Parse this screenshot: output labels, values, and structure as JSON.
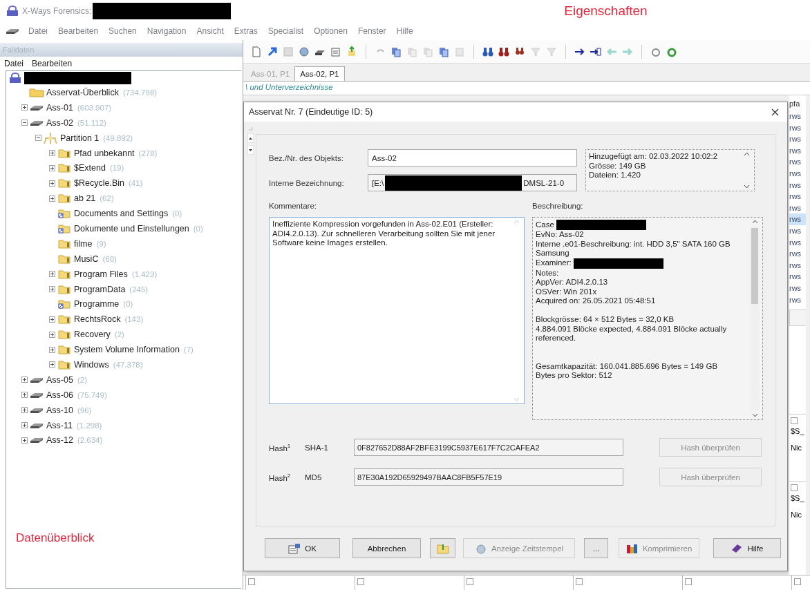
{
  "window": {
    "title": "X-Ways Forensics:",
    "annotation": "Eigenschaften"
  },
  "menu": [
    "Datei",
    "Bearbeiten",
    "Suchen",
    "Navigation",
    "Ansicht",
    "Extras",
    "Specialist",
    "Optionen",
    "Fenster",
    "Hilfe"
  ],
  "case_panel": {
    "title": "Falldaten",
    "menu": [
      "Datei",
      "Bearbeiten"
    ],
    "annotation": "Datenüberblick",
    "tree": [
      {
        "label": "Asservat-Überblick",
        "count": "(734.798)",
        "kind": "overview"
      },
      {
        "label": "Ass-01",
        "count": "(603.907)",
        "kind": "drive",
        "expanded": false
      },
      {
        "label": "Ass-02",
        "count": "(51.112)",
        "kind": "drive",
        "expanded": true,
        "children": [
          {
            "label": "Partition 1",
            "count": "(49.892)",
            "kind": "partition",
            "expanded": true,
            "children": [
              {
                "label": "Pfad unbekannt",
                "count": "(278)",
                "kind": "folder",
                "expanded": false
              },
              {
                "label": "$Extend",
                "count": "(19)",
                "kind": "folder",
                "expanded": false
              },
              {
                "label": "$Recycle.Bin",
                "count": "(41)",
                "kind": "folder",
                "expanded": false
              },
              {
                "label": "ab 21",
                "count": "(62)",
                "kind": "folder",
                "expanded": false
              },
              {
                "label": "Documents and Settings",
                "count": "(0)",
                "kind": "link"
              },
              {
                "label": "Dokumente und Einstellungen",
                "count": "(0)",
                "kind": "link"
              },
              {
                "label": "filme",
                "count": "(9)",
                "kind": "folder"
              },
              {
                "label": "MusiC",
                "count": "(60)",
                "kind": "folder"
              },
              {
                "label": "Program Files",
                "count": "(1.423)",
                "kind": "folder",
                "expanded": false
              },
              {
                "label": "ProgramData",
                "count": "(245)",
                "kind": "folder",
                "expanded": false
              },
              {
                "label": "Programme",
                "count": "(0)",
                "kind": "link"
              },
              {
                "label": "RechtsRock",
                "count": "(143)",
                "kind": "folder",
                "expanded": false
              },
              {
                "label": "Recovery",
                "count": "(2)",
                "kind": "folder",
                "expanded": false
              },
              {
                "label": "System Volume Information",
                "count": "(7)",
                "kind": "folder",
                "expanded": false
              },
              {
                "label": "Windows",
                "count": "(47.378)",
                "kind": "folder",
                "expanded": false
              }
            ]
          }
        ]
      },
      {
        "label": "Ass-05",
        "count": "(2)",
        "kind": "drive",
        "expanded": false
      },
      {
        "label": "Ass-06",
        "count": "(75.749)",
        "kind": "drive",
        "expanded": false
      },
      {
        "label": "Ass-10",
        "count": "(96)",
        "kind": "drive",
        "expanded": false
      },
      {
        "label": "Ass-11",
        "count": "(1.298)",
        "kind": "drive",
        "expanded": false
      },
      {
        "label": "Ass-12",
        "count": "(2.634)",
        "kind": "drive",
        "expanded": false
      }
    ]
  },
  "tabs": [
    {
      "label": "Ass-01, P1",
      "selected": false
    },
    {
      "label": "Ass-02, P1",
      "selected": true
    }
  ],
  "path": "\\ und Unterverzeichnisse",
  "dialog": {
    "title": "Asservat Nr. 7 (Eindeutige ID: 5)",
    "fields": [
      {
        "label": "Bez./Nr. des Objekts:",
        "value": "Ass-02"
      },
      {
        "label": "Interne Bezeichnung:",
        "value": "[E:\\",
        "value_end": "DMSL-21-0"
      }
    ],
    "info": [
      "Hinzugefügt am: 02.03.2022  10:02:2",
      "Grösse: 149 GB",
      "Dateien: 1.420"
    ],
    "comments_label": "Kommentare:",
    "comments": "Ineffiziente Kompression vorgefunden in Ass-02.E01 (Ersteller: ADI4.2.0.13). Zur schnelleren Verarbeitung sollten Sie mit jener Software keine Images erstellen.",
    "description_label": "Beschreibung:",
    "description": [
      [
        {
          "text": "Case",
          "redacted": true
        },
        {
          "text": "EvNo: Ass-02",
          "redacted": false
        },
        {
          "text": "Interne .e01-Beschreibung: int. HDD 3,5\" SATA 160 GB Samsung",
          "redacted": false
        },
        {
          "text": "Examiner:",
          "redacted": true
        },
        {
          "text": "Notes:",
          "redacted": false
        },
        {
          "text": "AppVer: ADI4.2.0.13",
          "redacted": false
        },
        {
          "text": "OSVer: Win 201x",
          "redacted": false
        },
        {
          "text": "Acquired on: 26.05.2021  05:48:51",
          "redacted": false
        }
      ],
      [
        {
          "text": "Blockgrösse: 64 × 512 Bytes = 32,0 KB",
          "redacted": false
        },
        {
          "text": "4.884.091 Blöcke expected, 4.884.091 Blöcke actually referenced.",
          "redacted": false
        }
      ],
      [
        {
          "text": "Gesamtkapazität: 160.041.885.696 Bytes = 149 GB",
          "redacted": false
        },
        {
          "text": "Bytes pro Sektor: 512",
          "redacted": false
        }
      ]
    ],
    "hashes": [
      {
        "label": "Hash$^{1}$",
        "type": "SHA-1",
        "value": "0F827652D88AF2BFE3199C5937E617F7C2CAFEA2",
        "button": "Hash überprüfen",
        "disabled": true
      },
      {
        "label": "Hash$^{2}$",
        "type": "MD5",
        "value": "87E30A192D65929497BAAC8FB5F57E19",
        "button": "Hash überprüfen",
        "disabled": true
      }
    ],
    "buttons": [
      {
        "label": "OK",
        "kind": "ok",
        "disabled": false
      },
      {
        "label": "Abbrechen",
        "kind": "text",
        "disabled": false
      },
      {
        "kind": "folder",
        "disabled": false
      },
      {
        "label": "Anzeige Zeitstempel",
        "kind": "globe",
        "disabled": true
      },
      {
        "label": "...",
        "kind": "text",
        "disabled": false
      },
      {
        "label": "Komprimieren",
        "kind": "chart",
        "disabled": true
      },
      {
        "label": "Hilfe",
        "kind": "book",
        "disabled": false
      }
    ]
  },
  "file_list": {
    "header": "pfa",
    "rows": [
      {
        "text": "rws",
        "selected": false
      },
      {
        "text": "rws",
        "selected": false
      },
      {
        "text": "rws",
        "selected": false
      },
      {
        "text": "rws",
        "selected": false
      },
      {
        "text": "rws",
        "selected": false
      },
      {
        "text": "rws",
        "selected": false
      },
      {
        "text": "rws",
        "selected": false
      },
      {
        "text": "rws",
        "selected": false
      },
      {
        "text": "rws",
        "selected": false
      },
      {
        "text": "rws",
        "selected": true
      },
      {
        "text": "rws",
        "selected": false
      },
      {
        "text": "rws",
        "selected": false
      },
      {
        "text": "rws",
        "selected": false
      },
      {
        "text": "rws",
        "selected": false
      },
      {
        "text": "rws",
        "selected": false
      },
      {
        "text": "rws",
        "selected": false
      },
      {
        "text": "rws",
        "selected": false
      }
    ],
    "tiles": [
      {
        "name": "$S_",
        "note": "Nic",
        "checked": false
      },
      {
        "name": "$S_",
        "note": "Nic",
        "checked": false
      }
    ],
    "bottom_tiles": [
      {
        "checked": false
      },
      {
        "checked": false
      },
      {
        "checked": false
      },
      {
        "checked": false
      },
      {
        "checked": false
      },
      {
        "checked": false
      }
    ]
  }
}
